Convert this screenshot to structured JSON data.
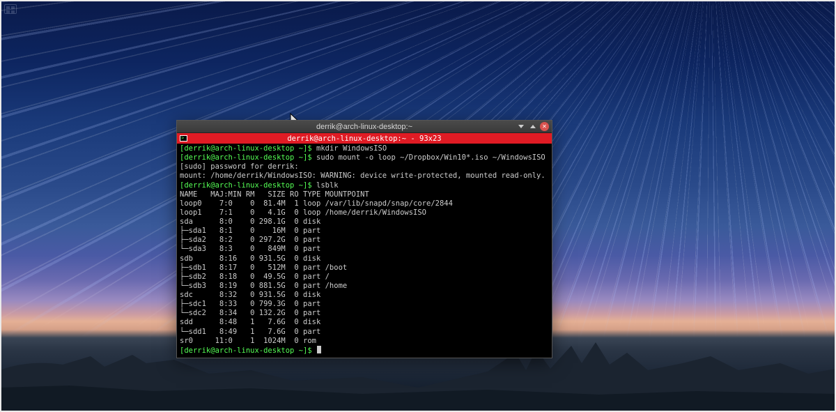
{
  "window": {
    "title": "derrik@arch-linux-desktop:~",
    "menubar": "derrik@arch-linux-desktop:~ - 93x23"
  },
  "prompt": {
    "user_host": "derrik@arch-linux-desktop",
    "path": "~",
    "open": "[",
    "close": "]$"
  },
  "cmds": {
    "c1": "mkdir WindowsISO",
    "c2": "sudo mount -o loop ~/Dropbox/Win10*.iso ~/WindowsISO",
    "c3": "lsblk"
  },
  "lines": {
    "sudo": "[sudo] password for derrik:",
    "mount": "mount: /home/derrik/WindowsISO: WARNING: device write-protected, mounted read-only.",
    "header": "NAME   MAJ:MIN RM   SIZE RO TYPE MOUNTPOINT"
  },
  "lsblk": [
    "loop0    7:0    0  81.4M  1 loop /var/lib/snapd/snap/core/2844",
    "loop1    7:1    0   4.1G  0 loop /home/derrik/WindowsISO",
    "sda      8:0    0 298.1G  0 disk ",
    "├─sda1   8:1    0    16M  0 part ",
    "├─sda2   8:2    0 297.2G  0 part ",
    "└─sda3   8:3    0   849M  0 part ",
    "sdb      8:16   0 931.5G  0 disk ",
    "├─sdb1   8:17   0   512M  0 part /boot",
    "├─sdb2   8:18   0  49.5G  0 part /",
    "└─sdb3   8:19   0 881.5G  0 part /home",
    "sdc      8:32   0 931.5G  0 disk ",
    "├─sdc1   8:33   0 799.3G  0 part ",
    "└─sdc2   8:34   0 132.2G  0 part ",
    "sdd      8:48   1   7.6G  0 disk ",
    "└─sdd1   8:49   1   7.6G  0 part ",
    "sr0     11:0    1  1024M  0 rom  "
  ]
}
